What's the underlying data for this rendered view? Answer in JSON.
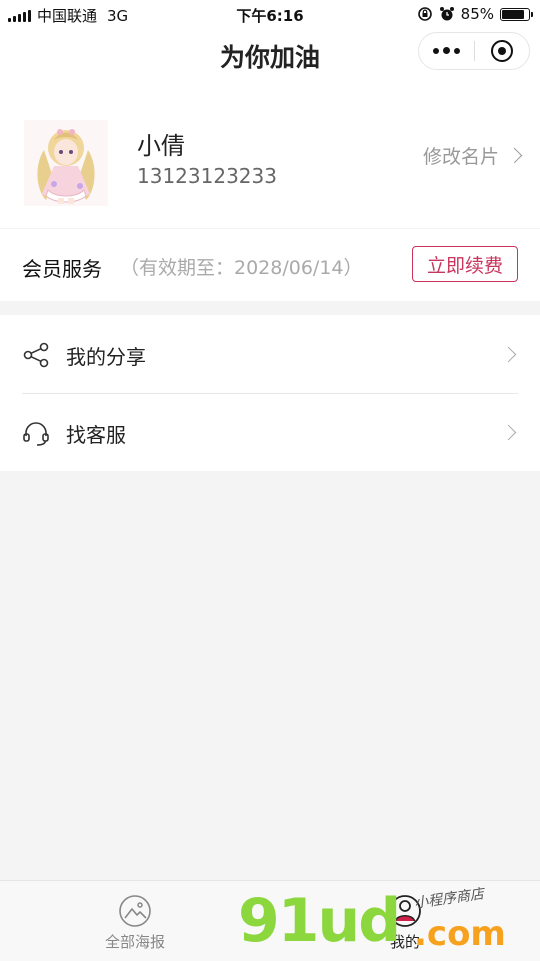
{
  "status_bar": {
    "carrier": "中国联通",
    "network": "3G",
    "time": "下午6:16",
    "battery": "85%",
    "battery_level": 0.85
  },
  "navbar": {
    "title": "为你加油",
    "more_icon": "more-dots-icon",
    "close_icon": "target-icon"
  },
  "profile": {
    "name": "小倩",
    "phone": "13123123233",
    "edit_label": "修改名片"
  },
  "membership": {
    "label": "会员服务",
    "expiry": "（有效期至：2028/06/14）",
    "renew_label": "立即续费",
    "accent": "#c8365e"
  },
  "menu": {
    "items": [
      {
        "label": "我的分享",
        "icon": "share-icon"
      },
      {
        "label": "找客服",
        "icon": "headset-icon"
      }
    ]
  },
  "tabbar": {
    "tabs": [
      {
        "label": "全部海报",
        "icon": "image-icon"
      },
      {
        "label": "我的",
        "icon": "user-icon"
      }
    ]
  },
  "watermark": {
    "brand": "91ud",
    "domain": ".com",
    "tagline": "小程序商店"
  }
}
